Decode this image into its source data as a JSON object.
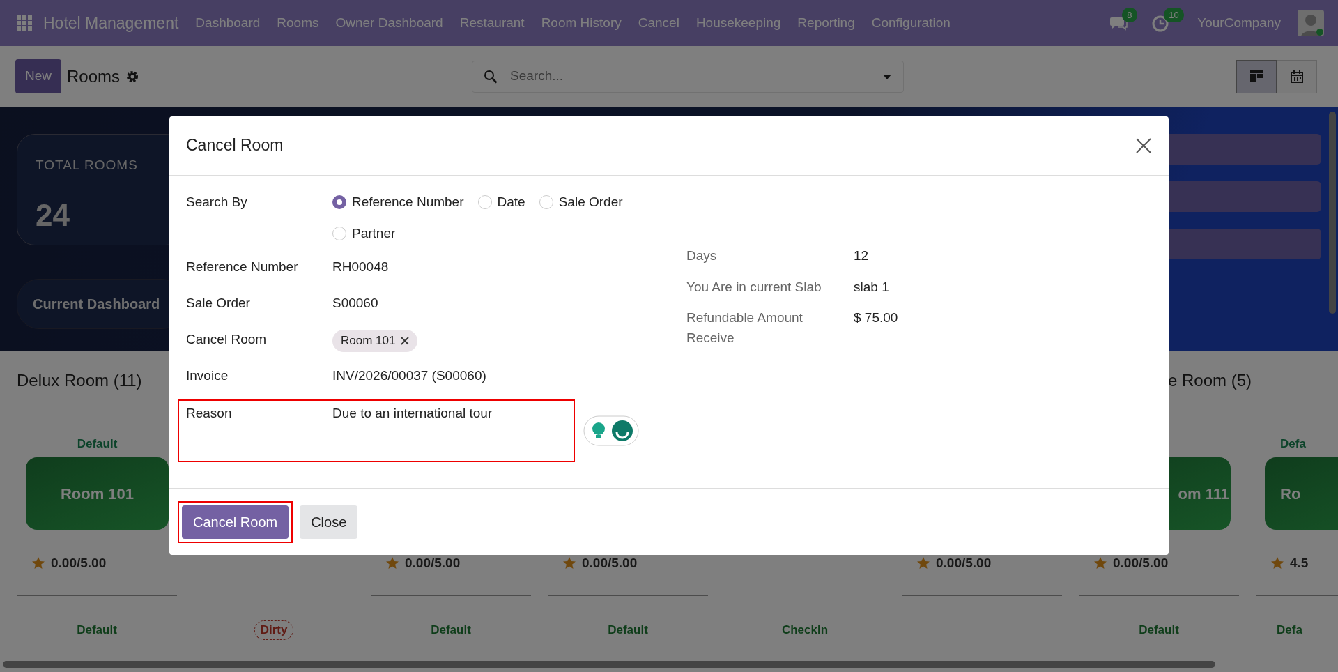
{
  "navbar": {
    "app_name": "Hotel Management",
    "menu": [
      "Dashboard",
      "Rooms",
      "Owner Dashboard",
      "Restaurant",
      "Room History",
      "Cancel",
      "Housekeeping",
      "Reporting",
      "Configuration"
    ],
    "messages_count": "8",
    "activities_count": "10",
    "company": "YourCompany"
  },
  "control_panel": {
    "new_button": "New",
    "title": "Rooms",
    "search_placeholder": "Search...",
    "views": [
      {
        "kind": "kanban",
        "selected": true
      },
      {
        "kind": "calendar",
        "selected": false
      }
    ]
  },
  "dashboard": {
    "stat_label": "TOTAL ROOMS",
    "stat_value": "24",
    "current_dashboard": "Current Dashboard"
  },
  "groups": [
    {
      "title": "Delux Room (11)"
    },
    {
      "title": "e Room (5)"
    }
  ],
  "cards_row1": [
    {
      "kind": "room",
      "label": "Default",
      "room": "Room 101",
      "rating": "0.00/5.00"
    },
    {
      "kind": "blank"
    },
    {
      "kind": "room",
      "rating": "0.00/5.00"
    },
    {
      "kind": "room",
      "rating": "0.00/5.00"
    },
    {
      "kind": "blank"
    },
    {
      "kind": "room",
      "rating": "0.00/5.00"
    },
    {
      "kind": "room",
      "room": "om 111",
      "rating": "0.00/5.00"
    },
    {
      "kind": "room",
      "label": "Defa",
      "room": "Ro",
      "rating": "4.5"
    }
  ],
  "cards_row2": [
    {
      "label": "Default",
      "kind": "status"
    },
    {
      "label": "Dirty",
      "kind": "dirty"
    },
    {
      "label": "Default",
      "kind": "status"
    },
    {
      "label": "Default",
      "kind": "status"
    },
    {
      "label": "CheckIn",
      "kind": "status"
    },
    {
      "kind": "blank"
    },
    {
      "label": "Default",
      "kind": "status"
    },
    {
      "label": "Defa",
      "kind": "status"
    }
  ],
  "dialog": {
    "title": "Cancel Room",
    "search_by": {
      "label": "Search By",
      "options": [
        {
          "label": "Reference Number",
          "selected": true
        },
        {
          "label": "Date",
          "selected": false
        },
        {
          "label": "Sale Order",
          "selected": false
        },
        {
          "label": "Partner",
          "selected": false
        }
      ]
    },
    "left_fields": [
      {
        "label": "Reference Number",
        "value": "RH00048",
        "kind": "text"
      },
      {
        "label": "Sale Order",
        "value": "S00060",
        "kind": "text"
      },
      {
        "label": "Cancel Room",
        "value": "Room 101",
        "kind": "tag"
      },
      {
        "label": "Invoice",
        "value": "INV/2026/00037 (S00060)",
        "kind": "text"
      },
      {
        "label": "Reason",
        "value": "Due to an international tour",
        "kind": "text",
        "highlighted": true
      }
    ],
    "right_fields": [
      {
        "label": "Days",
        "value": "12"
      },
      {
        "label": "You Are in current Slab",
        "value": "slab 1"
      },
      {
        "label": "Refundable Amount Receive",
        "value": "$ 75.00"
      }
    ],
    "buttons": [
      {
        "label": "Cancel Room",
        "kind": "primary",
        "highlighted": true
      },
      {
        "label": "Close",
        "kind": "secondary",
        "highlighted": false
      }
    ]
  }
}
